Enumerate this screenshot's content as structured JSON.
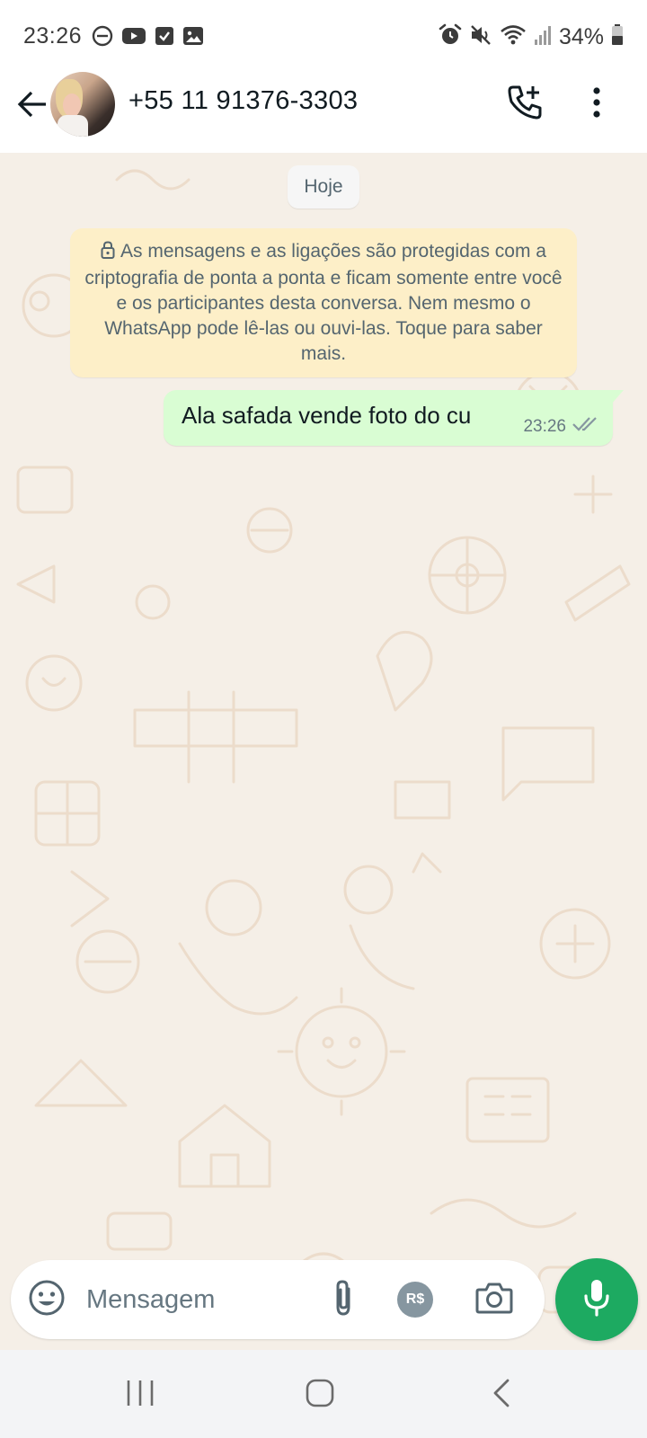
{
  "status_bar": {
    "time": "23:26",
    "battery": "34%",
    "left_icons": [
      "do-not-disturb-icon",
      "youtube-icon",
      "checkbox-icon",
      "gallery-icon"
    ],
    "right_icons": [
      "alarm-icon",
      "mute-icon",
      "wifi-icon",
      "signal-icon",
      "battery-icon"
    ]
  },
  "header": {
    "contact_name": "+55 11 91376-3303",
    "icons": [
      "back-arrow-icon",
      "add-call-icon",
      "more-vert-icon"
    ]
  },
  "chat": {
    "date_chip": "Hoje",
    "encryption_notice": "As mensagens e as ligações são protegidas com a criptografia de ponta a ponta e ficam somente entre você e os participantes desta conversa. Nem mesmo o WhatsApp pode lê-las ou ouvi-las. Toque para saber mais.",
    "messages": [
      {
        "direction": "outgoing",
        "text": "Ala safada vende foto do cu",
        "time": "23:26",
        "status": "delivered"
      }
    ],
    "colors": {
      "wallpaper": "#f5efe7",
      "outgoing_bubble": "#d9fdd3",
      "notice_bg": "#fdefc8"
    }
  },
  "composer": {
    "placeholder": "Mensagem",
    "payment_label": "R$",
    "icons": [
      "emoji-icon",
      "paperclip-icon",
      "payment-icon",
      "camera-icon",
      "mic-icon"
    ],
    "accent": "#1daa61"
  },
  "nav_bar": {
    "icons": [
      "recent-apps-icon",
      "home-icon",
      "nav-back-icon"
    ]
  }
}
